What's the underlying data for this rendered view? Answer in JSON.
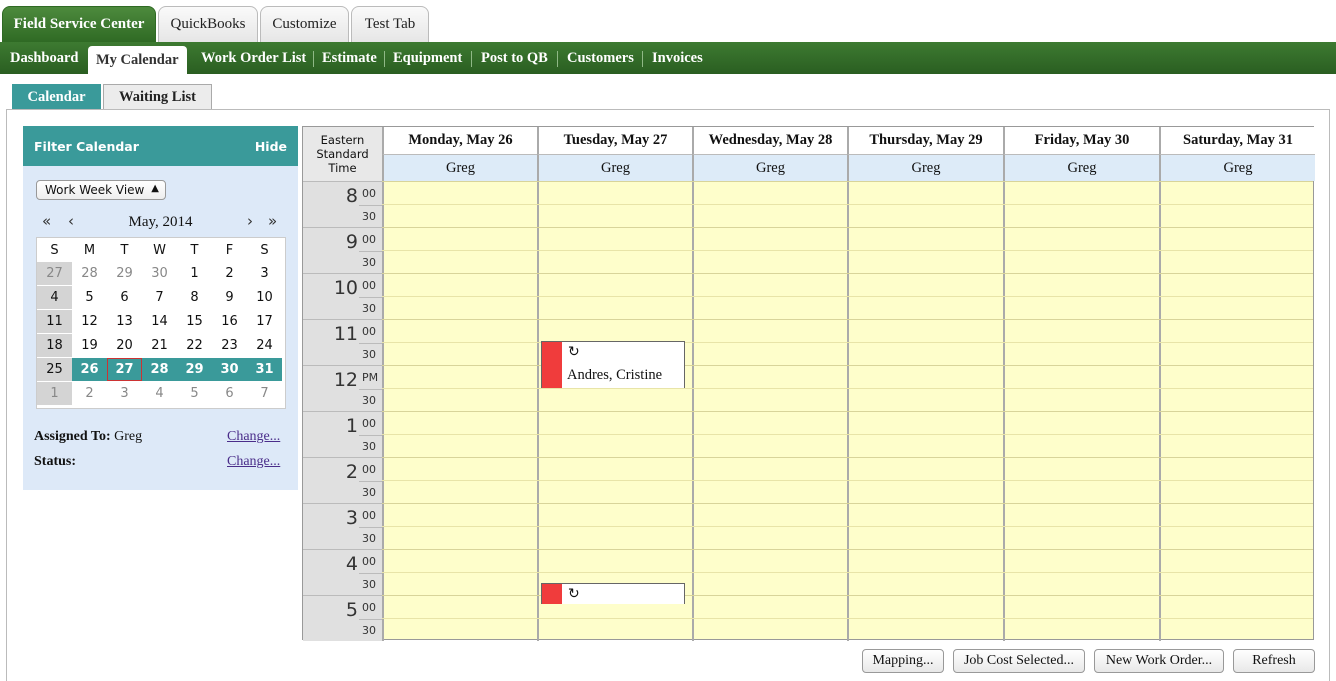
{
  "app_tabs": [
    "Field Service Center",
    "QuickBooks",
    "Customize",
    "Test Tab"
  ],
  "nav": [
    "Dashboard",
    "My Calendar",
    "Work Order List",
    "Estimate",
    "Equipment",
    "Post to QB",
    "Customers",
    "Invoices"
  ],
  "sub_tabs": [
    "Calendar",
    "Waiting List"
  ],
  "filter": {
    "title": "Filter Calendar",
    "hide": "Hide",
    "view": "Work Week View",
    "month": "May, 2014",
    "nav_first": "«",
    "nav_prev": "‹",
    "nav_next": "›",
    "nav_last": "»",
    "weekdays": [
      "S",
      "M",
      "T",
      "W",
      "T",
      "F",
      "S"
    ],
    "weeks": [
      [
        "27",
        "28",
        "29",
        "30",
        "1",
        "2",
        "3"
      ],
      [
        "4",
        "5",
        "6",
        "7",
        "8",
        "9",
        "10"
      ],
      [
        "11",
        "12",
        "13",
        "14",
        "15",
        "16",
        "17"
      ],
      [
        "18",
        "19",
        "20",
        "21",
        "22",
        "23",
        "24"
      ],
      [
        "25",
        "26",
        "27",
        "28",
        "29",
        "30",
        "31"
      ],
      [
        "1",
        "2",
        "3",
        "4",
        "5",
        "6",
        "7"
      ]
    ],
    "assigned_label": "Assigned To:",
    "assigned_value": "Greg",
    "status_label": "Status:",
    "change": "Change..."
  },
  "calendar": {
    "tz": "Eastern Standard Time",
    "days": [
      "Monday, May 26",
      "Tuesday, May 27",
      "Wednesday, May 28",
      "Thursday, May 29",
      "Friday, May 30",
      "Saturday, May 31"
    ],
    "resource": "Greg",
    "hours": [
      "8",
      "9",
      "10",
      "11",
      "12",
      "1",
      "2",
      "3",
      "4",
      "5"
    ],
    "minutes_top": [
      "00",
      "00",
      "00",
      "00",
      "PM",
      "00",
      "00",
      "00",
      "00",
      "00"
    ],
    "minutes_half": "30",
    "events": [
      {
        "name": "Andres, Cristine",
        "icon": "↻"
      },
      {
        "name": "",
        "icon": "↻"
      }
    ]
  },
  "buttons": [
    "Mapping...",
    "Job Cost Selected...",
    "New Work Order...",
    "Refresh"
  ],
  "colors": {
    "green": "#2f6a24",
    "teal": "#3a9a9a",
    "event": "#f03c3c",
    "slot": "#fefecb"
  }
}
